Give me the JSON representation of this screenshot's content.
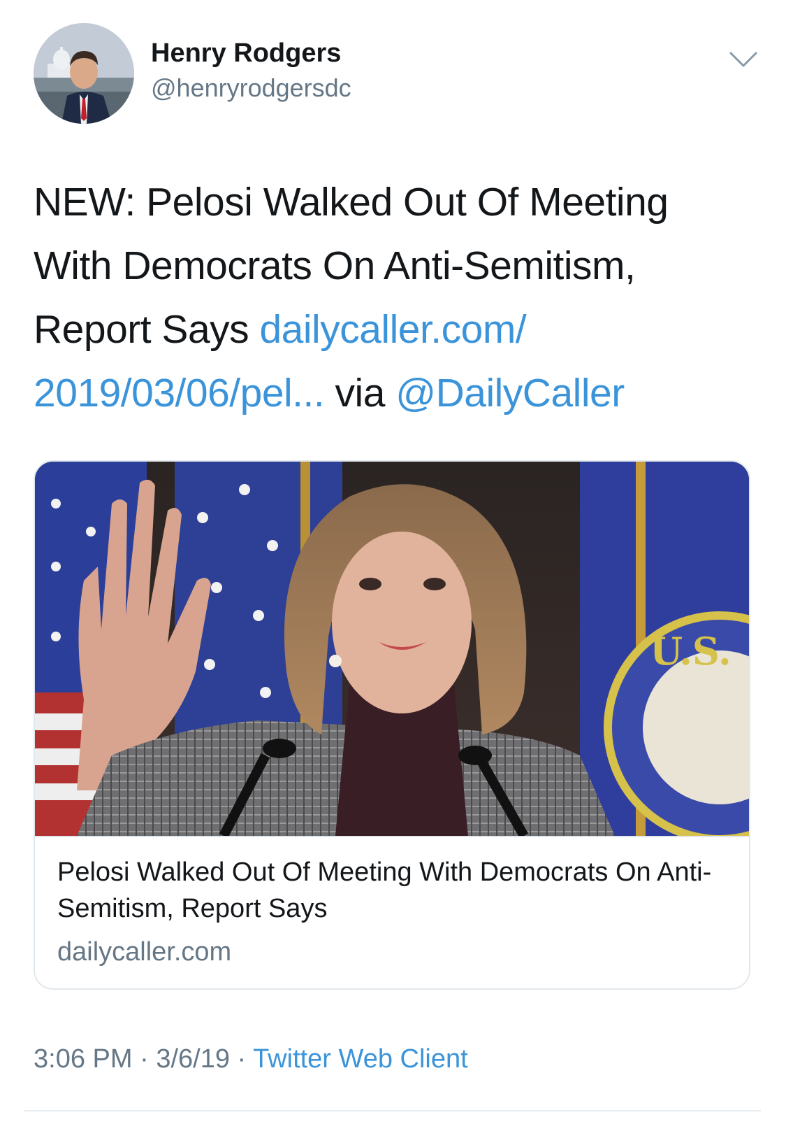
{
  "author": {
    "name": "Henry Rodgers",
    "handle": "@henryrodgersdc",
    "avatar_icon": "profile-photo"
  },
  "menu": {
    "caret_icon": "chevron-down-icon"
  },
  "tweet": {
    "text_line1": "NEW: Pelosi Walked Out Of Meeting",
    "text_line2": "With Democrats On Anti-Semitism,",
    "text_line3_plain": "Report Says ",
    "link_part1": "dailycaller.com/",
    "link_part2": "2019/03/06/pel...",
    "via_text": " via ",
    "mention": "@DailyCaller"
  },
  "card": {
    "title": "Pelosi Walked Out Of Meeting With Democrats On Anti-Semitism, Report Says",
    "domain": "dailycaller.com",
    "image_alt": "Nancy Pelosi raising her hand in front of American flags"
  },
  "meta": {
    "time": "3:06 PM",
    "separator": " · ",
    "date": "3/6/19",
    "source": "Twitter Web Client"
  },
  "colors": {
    "link": "#3b94d9",
    "secondary_text": "#657786",
    "border": "#e1e8ed"
  }
}
